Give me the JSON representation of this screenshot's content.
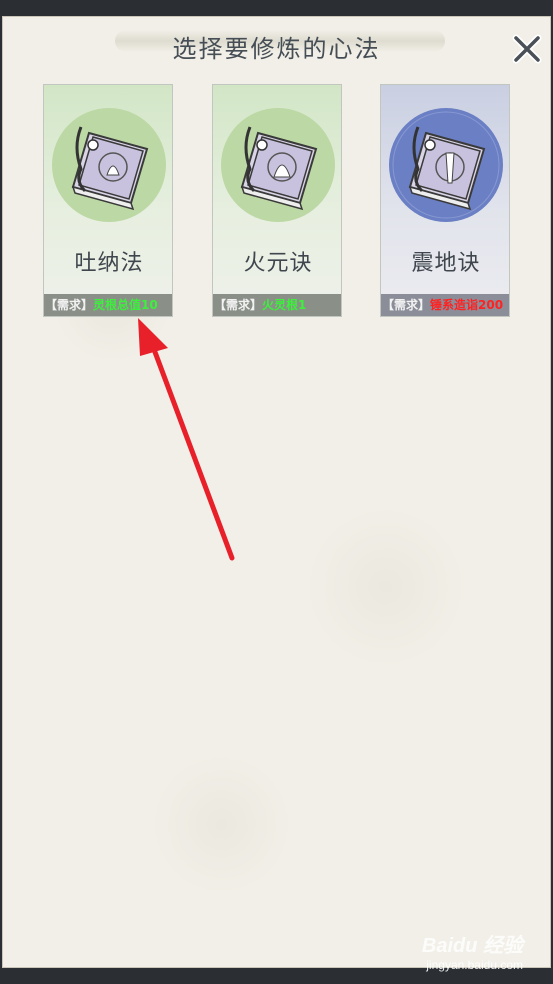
{
  "dialog": {
    "title": "选择要修炼的心法",
    "close_icon": "close-icon"
  },
  "cards": [
    {
      "name": "吐纳法",
      "req_tag": "【需求】",
      "req_value": "灵根总值10",
      "req_color": "#3cf03c",
      "theme": "green",
      "icon": "manual-book-icon"
    },
    {
      "name": "火元诀",
      "req_tag": "【需求】",
      "req_value": "火灵根1",
      "req_color": "#3cf03c",
      "theme": "green",
      "icon": "manual-book-icon"
    },
    {
      "name": "震地诀",
      "req_tag": "【需求】",
      "req_value": "锤系造诣200",
      "req_color": "#ff2222",
      "theme": "blue",
      "icon": "manual-book-icon"
    }
  ],
  "annotation": {
    "arrow_color": "#e8202a"
  },
  "watermark": {
    "logo": "Baidu 经验",
    "url": "jingyan.baidu.com"
  }
}
